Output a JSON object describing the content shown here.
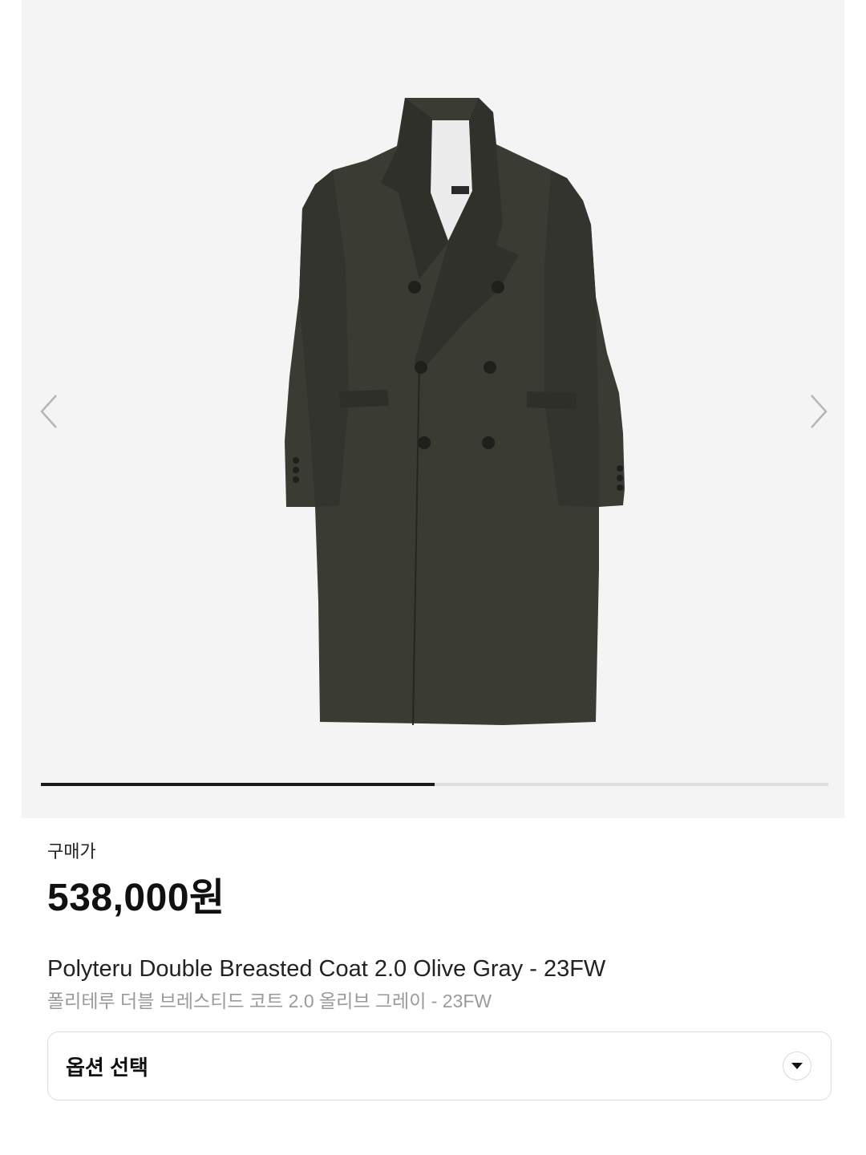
{
  "gallery": {
    "image_alt": "olive-gray-double-breasted-coat",
    "prev_icon": "chevron-left-icon",
    "next_icon": "chevron-right-icon",
    "progress": 0.5
  },
  "product": {
    "price_label": "구매가",
    "price": "538,000원",
    "title_en": "Polyteru Double Breasted Coat 2.0 Olive Gray - 23FW",
    "title_ko": "폴리테루 더블 브레스티드 코트 2.0 올리브 그레이 - 23FW"
  },
  "options": {
    "label": "옵션 선택",
    "icon": "caret-down-icon"
  },
  "colors": {
    "coat": "#3a3b33",
    "gallery_bg": "#f4f4f4",
    "progress_active": "#1a1a1a"
  }
}
